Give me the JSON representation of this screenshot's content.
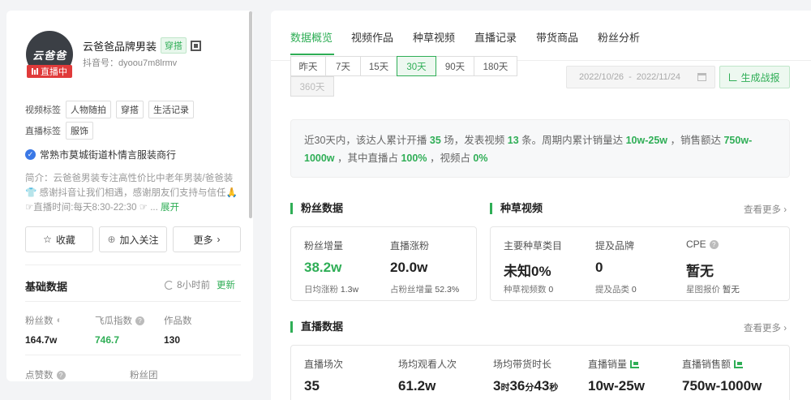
{
  "profile": {
    "avatar_text": "云爸爸",
    "live_badge": "直播中",
    "name": "云爸爸品牌男装",
    "tag": "穿搭",
    "douyin_id": "抖音号：dyoou7m8lrmv",
    "video_tags_label": "视频标签",
    "video_tags": [
      "人物随拍",
      "穿搭",
      "生活记录"
    ],
    "live_tags_label": "直播标签",
    "live_tags": [
      "服饰"
    ],
    "company": "常熟市莫城街道朴情言服装商行",
    "intro": "简介：云爸爸男装专注高性价比中老年男装/爸爸装👕 感谢抖音让我们相遇，感谢朋友们支持与信任🙏 ☞直播时间:每天8:30-22:30 ☞ ...",
    "intro_more": "展开",
    "buttons": {
      "favorite": "收藏",
      "follow": "加入关注",
      "more": "更多"
    }
  },
  "basic": {
    "title": "基础数据",
    "update_time": "8小时前",
    "update_link": "更新",
    "stats": [
      {
        "label": "粉丝数",
        "value": "164.7w"
      },
      {
        "label": "飞瓜指数",
        "value": "746.7"
      },
      {
        "label": "作品数",
        "value": "130"
      },
      {
        "label": "点赞数",
        "value": ""
      },
      {
        "label": "粉丝团",
        "value": ""
      }
    ]
  },
  "tabs": [
    "数据概览",
    "视频作品",
    "种草视频",
    "直播记录",
    "带货商品",
    "粉丝分析"
  ],
  "ranges": [
    "昨天",
    "7天",
    "15天",
    "30天",
    "90天",
    "180天",
    "360天"
  ],
  "date_range": {
    "start": "2022/10/26",
    "sep": "-",
    "end": "2022/11/24"
  },
  "report_btn": "生成战报",
  "summary": {
    "p1": "近30天内，该达人累计开播 ",
    "live_count": "35",
    "p2": " 场，发表视频 ",
    "video_count": "13",
    "p3": " 条。周期内累计销量达 ",
    "sales": "10w-25w",
    "p4": " ，销售额达 ",
    "revenue": "750w-1000w",
    "p5": " ，其中直播占 ",
    "live_pct": "100%",
    "p6": " ，视频占 ",
    "video_pct": "0%"
  },
  "fans": {
    "title": "粉丝数据",
    "growth_label": "粉丝增量",
    "growth_value": "38.2w",
    "growth_sub_label": "日均涨粉",
    "growth_sub_value": "1.3w",
    "live_growth_label": "直播涨粉",
    "live_growth_value": "20.0w",
    "live_growth_sub_label": "占粉丝增量",
    "live_growth_sub_value": "52.3%"
  },
  "seeding": {
    "title": "种草视频",
    "see_more": "查看更多 ›",
    "category_label": "主要种草类目",
    "category_value": "未知0%",
    "category_sub_label": "种草视频数",
    "category_sub_value": "0",
    "brand_label": "提及品牌",
    "brand_value": "0",
    "brand_sub_label": "提及品类",
    "brand_sub_value": "0",
    "cpe_label": "CPE",
    "cpe_value": "暂无",
    "cpe_sub_label": "星图报价",
    "cpe_sub_value": "暂无"
  },
  "live": {
    "title": "直播数据",
    "see_more": "查看更多 ›",
    "sessions_label": "直播场次",
    "sessions_value": "35",
    "avg_viewers_label": "场均观看人次",
    "avg_viewers_value": "61.2w",
    "duration_label": "场均带货时长",
    "duration_h": "3",
    "duration_h_unit": "时",
    "duration_m": "36",
    "duration_m_unit": "分",
    "duration_s": "43",
    "duration_s_unit": "秒",
    "sales_label": "直播销量",
    "sales_value": "10w-25w",
    "revenue_label": "直播销售额",
    "revenue_value": "750w-1000w"
  }
}
